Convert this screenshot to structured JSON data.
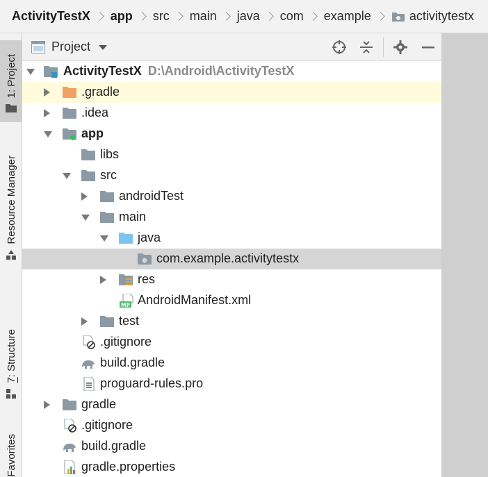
{
  "breadcrumb": {
    "items": [
      "ActivityTestX",
      "app",
      "src",
      "main",
      "java",
      "com",
      "example",
      "activitytestx"
    ]
  },
  "stripe": {
    "project_tab": "1: Project",
    "resource_tab": "Resource Manager",
    "structure_tab": "7: Structure",
    "favorites_tab": "Favorites"
  },
  "project_panel": {
    "title": "Project"
  },
  "tree": {
    "rows": [
      {
        "label": "ActivityTestX",
        "path": "D:\\Android\\ActivityTestX"
      },
      {
        "label": ".gradle"
      },
      {
        "label": ".idea"
      },
      {
        "label": "app"
      },
      {
        "label": "libs"
      },
      {
        "label": "src"
      },
      {
        "label": "androidTest"
      },
      {
        "label": "main"
      },
      {
        "label": "java"
      },
      {
        "label": "com.example.activitytestx"
      },
      {
        "label": "res"
      },
      {
        "label": "AndroidManifest.xml"
      },
      {
        "label": "test"
      },
      {
        "label": ".gitignore"
      },
      {
        "label": "build.gradle"
      },
      {
        "label": "proguard-rules.pro"
      },
      {
        "label": "gradle"
      },
      {
        "label": ".gitignore"
      },
      {
        "label": "build.gradle"
      },
      {
        "label": "gradle.properties"
      }
    ]
  },
  "icons": {
    "folder": "folder-icon",
    "module": "module-folder-icon",
    "package": "package-icon",
    "manifest": "manifest-icon",
    "gradle": "gradle-elephant-icon",
    "ignore": "gitignore-icon",
    "text": "text-file-icon",
    "properties": "properties-icon"
  },
  "colors": {
    "selection": "#d5d5d5",
    "highlight": "#fffbdc",
    "folder": "#8c9aa5",
    "gradle_folder": "#f0a060",
    "java_folder": "#7ec3ee"
  }
}
